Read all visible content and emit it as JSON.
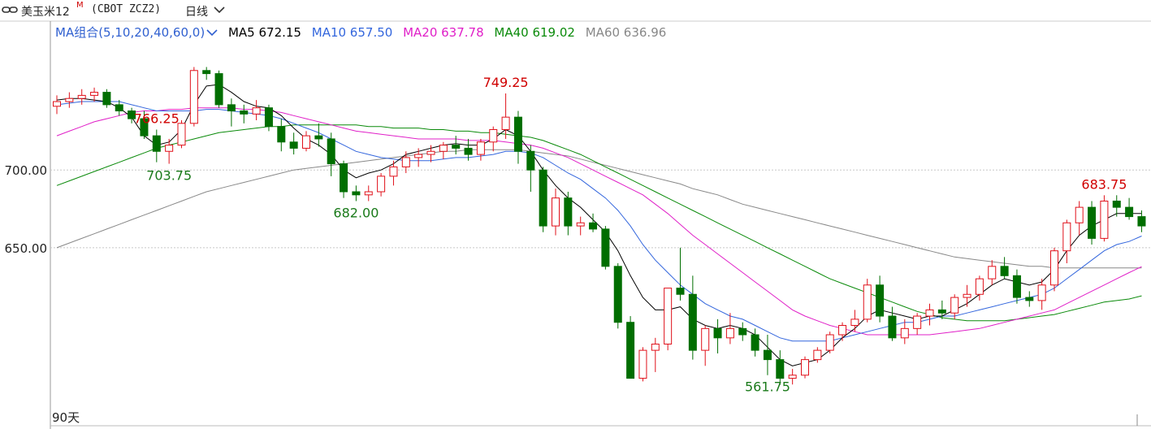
{
  "header": {
    "symbol_name": "美玉米12",
    "symbol_sup": "M",
    "symbol_code": "(CBOT ZCZ2)",
    "period": "日线",
    "link_icon": "link-icon",
    "dropdown_icon": "chevron-down-icon"
  },
  "ma_bar": {
    "combo": "MA组合(5,10,20,40,60,0)",
    "ma5": "MA5 672.15",
    "ma10": "MA10 657.50",
    "ma20": "MA20 637.78",
    "ma40": "MA40 619.02",
    "ma60": "MA60 636.96"
  },
  "footer": {
    "days": "90天"
  },
  "colors": {
    "up": "#e0101a",
    "down": "#006e00",
    "ma5": "#000000",
    "ma10": "#3366dd",
    "ma20": "#e020c8",
    "ma40": "#0a8a0a",
    "ma60": "#888888"
  },
  "chart_data": {
    "type": "candlestick",
    "title": "美玉米12M (CBOT ZCZ2) 日线",
    "y_ticks": [
      "700.00",
      "650.00"
    ],
    "y_tick_values": [
      700,
      650
    ],
    "ylim": [
      548,
      778
    ],
    "grid": "horizontal dashed",
    "annotations": [
      {
        "label": "766.25",
        "kind": "high",
        "index": 8
      },
      {
        "label": "703.75",
        "kind": "low",
        "index": 9
      },
      {
        "label": "749.25",
        "kind": "high",
        "index": 36
      },
      {
        "label": "682.00",
        "kind": "low",
        "index": 24
      },
      {
        "label": "561.75",
        "kind": "low",
        "index": 57
      },
      {
        "label": "683.75",
        "kind": "high",
        "index": 84
      }
    ],
    "ohlc": [
      [
        741,
        748,
        736,
        744
      ],
      [
        744,
        750,
        740,
        746
      ],
      [
        746,
        752,
        742,
        748
      ],
      [
        748,
        753,
        744,
        750
      ],
      [
        750,
        752,
        740,
        742
      ],
      [
        742,
        745,
        735,
        738
      ],
      [
        738,
        740,
        730,
        733
      ],
      [
        733,
        738,
        720,
        722
      ],
      [
        722,
        726,
        705,
        712
      ],
      [
        712,
        720,
        704,
        716
      ],
      [
        716,
        732,
        714,
        730
      ],
      [
        730,
        766.25,
        728,
        764
      ],
      [
        764,
        766.25,
        758,
        762
      ],
      [
        762,
        764,
        740,
        742
      ],
      [
        742,
        746,
        728,
        738
      ],
      [
        738,
        742,
        730,
        736
      ],
      [
        736,
        745,
        732,
        740
      ],
      [
        740,
        742,
        725,
        728
      ],
      [
        728,
        733,
        712,
        718
      ],
      [
        718,
        724,
        710,
        714
      ],
      [
        714,
        725,
        712,
        722
      ],
      [
        722,
        730,
        715,
        720
      ],
      [
        720,
        724,
        696,
        704
      ],
      [
        704,
        706,
        682,
        686
      ],
      [
        686,
        690,
        680,
        684
      ],
      [
        684,
        690,
        680,
        686
      ],
      [
        686,
        698,
        683,
        696
      ],
      [
        696,
        706,
        690,
        702
      ],
      [
        702,
        712,
        698,
        708
      ],
      [
        708,
        714,
        702,
        710
      ],
      [
        710,
        716,
        705,
        712
      ],
      [
        712,
        718,
        707,
        716
      ],
      [
        716,
        722,
        710,
        714
      ],
      [
        714,
        720,
        706,
        710
      ],
      [
        710,
        720,
        706,
        718
      ],
      [
        718,
        728,
        712,
        726
      ],
      [
        726,
        749.25,
        720,
        734
      ],
      [
        734,
        738,
        704,
        712
      ],
      [
        712,
        716,
        686,
        700
      ],
      [
        700,
        702,
        660,
        664
      ],
      [
        664,
        688,
        658,
        682
      ],
      [
        682,
        686,
        658,
        664
      ],
      [
        664,
        670,
        658,
        666
      ],
      [
        666,
        672,
        660,
        662
      ],
      [
        662,
        664,
        636,
        638
      ],
      [
        638,
        640,
        598,
        602
      ],
      [
        602,
        606,
        566,
        566
      ],
      [
        566,
        586,
        564,
        584
      ],
      [
        584,
        592,
        570,
        588
      ],
      [
        588,
        624,
        584,
        624
      ],
      [
        624,
        650,
        616,
        620
      ],
      [
        620,
        632,
        578,
        584
      ],
      [
        584,
        600,
        574,
        598
      ],
      [
        598,
        604,
        582,
        592
      ],
      [
        592,
        608,
        588,
        598
      ],
      [
        598,
        602,
        590,
        594
      ],
      [
        594,
        598,
        580,
        584
      ],
      [
        584,
        594,
        568,
        578
      ],
      [
        578,
        584,
        561.75,
        566
      ],
      [
        566,
        572,
        562,
        568
      ],
      [
        568,
        580,
        566,
        578
      ],
      [
        578,
        586,
        576,
        584
      ],
      [
        584,
        596,
        582,
        594
      ],
      [
        594,
        602,
        590,
        600
      ],
      [
        600,
        610,
        596,
        604
      ],
      [
        604,
        630,
        602,
        626
      ],
      [
        626,
        632,
        602,
        606
      ],
      [
        606,
        612,
        590,
        592
      ],
      [
        592,
        604,
        588,
        598
      ],
      [
        598,
        608,
        594,
        606
      ],
      [
        606,
        614,
        600,
        610
      ],
      [
        610,
        616,
        604,
        608
      ],
      [
        608,
        620,
        604,
        618
      ],
      [
        618,
        626,
        612,
        620
      ],
      [
        620,
        632,
        616,
        630
      ],
      [
        630,
        642,
        626,
        638
      ],
      [
        638,
        644,
        630,
        632
      ],
      [
        632,
        636,
        614,
        618
      ],
      [
        618,
        622,
        612,
        616
      ],
      [
        616,
        630,
        610,
        626
      ],
      [
        626,
        650,
        622,
        648
      ],
      [
        648,
        668,
        640,
        666
      ],
      [
        666,
        680,
        658,
        676
      ],
      [
        676,
        680,
        652,
        656
      ],
      [
        656,
        683.75,
        654,
        680
      ],
      [
        680,
        683.75,
        670,
        676
      ],
      [
        676,
        682,
        668,
        670
      ],
      [
        670,
        674,
        660,
        664
      ]
    ],
    "ma_series": {
      "MA5": [
        745,
        746,
        746,
        745,
        744,
        740,
        734,
        722,
        716,
        718,
        726,
        742,
        754,
        755,
        750,
        744,
        741,
        740,
        735,
        727,
        720,
        716,
        710,
        700,
        695,
        698,
        700,
        704,
        710,
        712,
        714,
        716,
        717,
        716,
        716,
        720,
        726,
        722,
        712,
        700,
        690,
        682,
        676,
        668,
        660,
        648,
        632,
        618,
        610,
        610,
        612,
        604,
        600,
        598,
        600,
        598,
        594,
        586,
        578,
        574,
        576,
        578,
        584,
        592,
        598,
        606,
        610,
        608,
        606,
        604,
        606,
        606,
        610,
        614,
        620,
        626,
        630,
        628,
        626,
        628,
        636,
        648,
        658,
        664,
        668,
        672,
        672,
        672
      ],
      "MA10": [
        742,
        743,
        744,
        744,
        744,
        744,
        742,
        740,
        738,
        738,
        738,
        738,
        739,
        739,
        738,
        737,
        736,
        735,
        733,
        730,
        727,
        724,
        720,
        716,
        712,
        710,
        708,
        707,
        706,
        706,
        706,
        707,
        708,
        708,
        709,
        710,
        712,
        712,
        711,
        708,
        703,
        698,
        694,
        688,
        682,
        674,
        664,
        652,
        642,
        634,
        626,
        620,
        614,
        610,
        606,
        604,
        600,
        596,
        592,
        590,
        590,
        590,
        590,
        592,
        594,
        596,
        598,
        600,
        602,
        602,
        604,
        606,
        606,
        608,
        610,
        612,
        614,
        616,
        618,
        620,
        624,
        630,
        636,
        642,
        648,
        652,
        654,
        657.5
      ],
      "MA20": [
        722,
        725,
        728,
        731,
        733,
        735,
        737,
        738,
        738,
        739,
        739,
        740,
        740,
        740,
        740,
        739,
        739,
        738,
        737,
        735,
        733,
        731,
        729,
        727,
        725,
        724,
        723,
        722,
        721,
        720,
        720,
        720,
        720,
        719,
        719,
        719,
        718,
        717,
        716,
        714,
        711,
        708,
        704,
        700,
        696,
        692,
        688,
        684,
        678,
        672,
        665,
        658,
        652,
        646,
        640,
        634,
        628,
        622,
        616,
        610,
        606,
        603,
        600,
        598,
        596,
        594,
        594,
        594,
        594,
        594,
        594,
        595,
        596,
        597,
        598,
        600,
        602,
        604,
        606,
        608,
        610,
        614,
        618,
        622,
        626,
        630,
        634,
        637.78
      ],
      "MA40": [
        690,
        693,
        696,
        699,
        702,
        705,
        708,
        711,
        714,
        716,
        718,
        720,
        722,
        724,
        725,
        726,
        727,
        728,
        728,
        729,
        729,
        729,
        729,
        729,
        729,
        728,
        728,
        727,
        727,
        727,
        726,
        726,
        725,
        725,
        724,
        724,
        723,
        722,
        721,
        719,
        716,
        713,
        710,
        706,
        702,
        698,
        694,
        690,
        686,
        682,
        678,
        674,
        670,
        666,
        662,
        658,
        654,
        650,
        646,
        642,
        638,
        634,
        630,
        627,
        624,
        621,
        618,
        615,
        612,
        609,
        607,
        605,
        604,
        603,
        603,
        603,
        603,
        604,
        605,
        606,
        607,
        609,
        611,
        613,
        615,
        616,
        617,
        619.02
      ],
      "MA60": [
        650,
        653,
        656,
        659,
        662,
        665,
        668,
        671,
        674,
        677,
        680,
        683,
        686,
        688,
        690,
        692,
        694,
        696,
        698,
        700,
        701,
        702,
        703,
        704,
        705,
        706,
        707,
        708,
        709,
        710,
        711,
        712,
        712,
        713,
        713,
        713,
        713,
        713,
        712,
        711,
        710,
        709,
        707,
        705,
        703,
        701,
        699,
        697,
        695,
        693,
        691,
        688,
        686,
        684,
        681,
        678,
        676,
        674,
        672,
        670,
        668,
        666,
        664,
        662,
        660,
        658,
        656,
        654,
        652,
        650,
        648,
        646,
        644,
        643,
        642,
        641,
        640,
        639,
        638,
        638,
        637,
        637,
        637,
        637,
        637,
        637,
        637,
        636.96
      ]
    }
  }
}
